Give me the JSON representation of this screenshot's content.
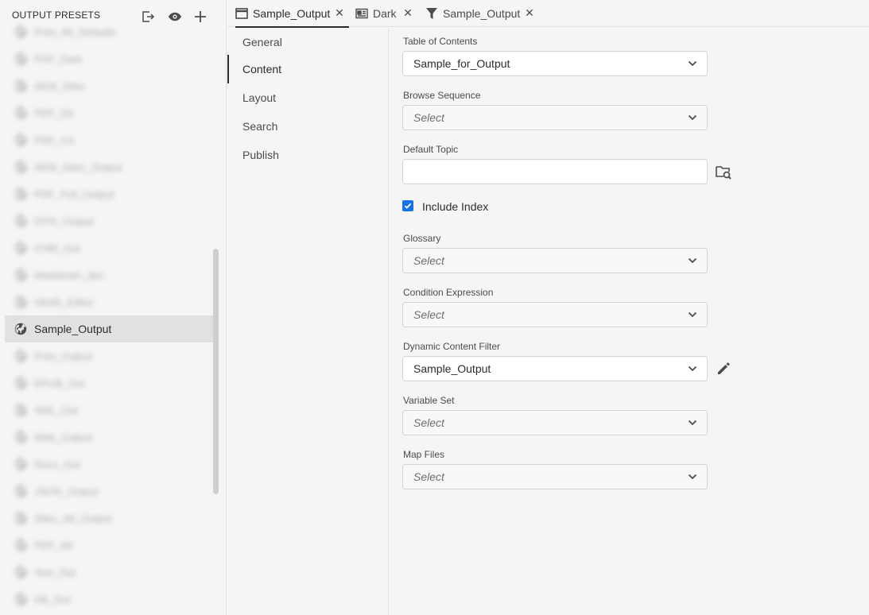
{
  "left_panel": {
    "title": "OUTPUT PRESETS",
    "header_icons": [
      "export-icon",
      "preview-eye-icon",
      "add-icon"
    ],
    "items": [
      {
        "label": "Print_All_Defaults",
        "blurred": true
      },
      {
        "label": "PDF_Dark",
        "blurred": true
      },
      {
        "label": "AEM_Sites",
        "blurred": true
      },
      {
        "label": "PDF_Dit",
        "blurred": true
      },
      {
        "label": "PDF_Cd",
        "blurred": true
      },
      {
        "label": "AEM_Sites_Output",
        "blurred": true
      },
      {
        "label": "PDF_Full_Output",
        "blurred": true
      },
      {
        "label": "DITA_Output",
        "blurred": true
      },
      {
        "label": "CHM_Out",
        "blurred": true
      },
      {
        "label": "Markdown_doc",
        "blurred": true
      },
      {
        "label": "Html5_Editor",
        "blurred": true
      },
      {
        "label": "Sample_Output",
        "blurred": false,
        "selected": true
      },
      {
        "label": "Print_Output",
        "blurred": true
      },
      {
        "label": "EPUB_Out",
        "blurred": true
      },
      {
        "label": "XML_Out",
        "blurred": true
      },
      {
        "label": "Web_Output",
        "blurred": true
      },
      {
        "label": "Docx_Out",
        "blurred": true
      },
      {
        "label": "JSON_Output",
        "blurred": true
      },
      {
        "label": "Sites_Alt_Output",
        "blurred": true
      },
      {
        "label": "PDF_Alt",
        "blurred": true
      },
      {
        "label": "Text_Out",
        "blurred": true
      },
      {
        "label": "KB_Out",
        "blurred": true
      }
    ]
  },
  "tabs": [
    {
      "label": "Sample_Output",
      "icon": "window-icon",
      "active": true
    },
    {
      "label": "Dark",
      "icon": "template-icon",
      "active": false
    },
    {
      "label": "Sample_Output",
      "icon": "filter-icon",
      "active": false
    }
  ],
  "subnav": {
    "items": [
      "General",
      "Content",
      "Layout",
      "Search",
      "Publish"
    ],
    "active": "Content"
  },
  "form": {
    "toc": {
      "label": "Table of Contents",
      "value": "Sample_for_Output"
    },
    "browse_sequence": {
      "label": "Browse Sequence",
      "value": "Select"
    },
    "default_topic": {
      "label": "Default Topic",
      "value": ""
    },
    "include_index": {
      "label": "Include Index",
      "checked": true
    },
    "glossary": {
      "label": "Glossary",
      "value": "Select"
    },
    "condition_expression": {
      "label": "Condition Expression",
      "value": "Select"
    },
    "dynamic_content_filter": {
      "label": "Dynamic Content Filter",
      "value": "Sample_Output"
    },
    "variable_set": {
      "label": "Variable Set",
      "value": "Select"
    },
    "map_files": {
      "label": "Map Files",
      "value": "Select"
    }
  },
  "colors": {
    "accent": "#1473e6",
    "selected_row": "#e1e1e1",
    "background": "#f5f5f5"
  }
}
